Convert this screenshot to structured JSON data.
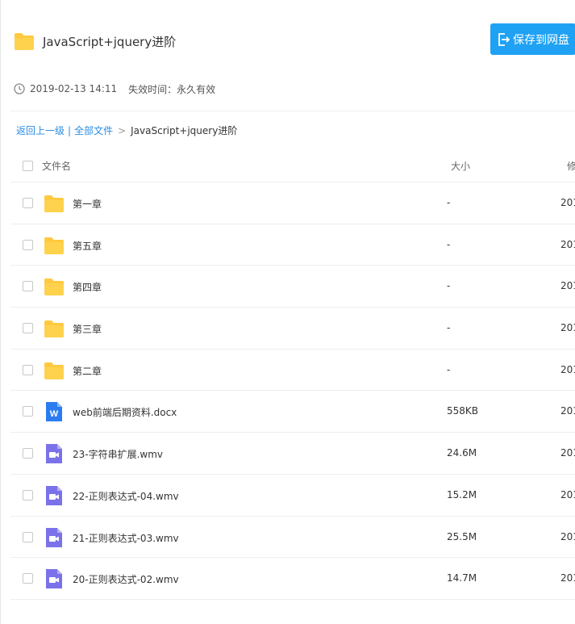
{
  "header": {
    "title": "JavaScript+jquery进阶",
    "save_button_label": "保存到网盘",
    "accent_color": "#1fa2f4"
  },
  "meta": {
    "share_time": "2019-02-13 14:11",
    "expiry_label": "失效时间：永久有效"
  },
  "breadcrumb": {
    "back_label": "返回上一级",
    "separator": "|",
    "all_files_label": "全部文件",
    "arrow": ">",
    "current": "JavaScript+jquery进阶"
  },
  "table": {
    "columns": {
      "name": "文件名",
      "size": "大小",
      "modified": "修"
    },
    "rows": [
      {
        "name": "第一章",
        "type": "folder",
        "size": "-",
        "date": "201"
      },
      {
        "name": "第五章",
        "type": "folder",
        "size": "-",
        "date": "201"
      },
      {
        "name": "第四章",
        "type": "folder",
        "size": "-",
        "date": "201"
      },
      {
        "name": "第三章",
        "type": "folder",
        "size": "-",
        "date": "201"
      },
      {
        "name": "第二章",
        "type": "folder",
        "size": "-",
        "date": "201"
      },
      {
        "name": "web前端后期资料.docx",
        "type": "word",
        "size": "558KB",
        "date": "201"
      },
      {
        "name": "23-字符串扩展.wmv",
        "type": "video",
        "size": "24.6M",
        "date": "201"
      },
      {
        "name": "22-正则表达式-04.wmv",
        "type": "video",
        "size": "15.2M",
        "date": "201"
      },
      {
        "name": "21-正则表达式-03.wmv",
        "type": "video",
        "size": "25.5M",
        "date": "201"
      },
      {
        "name": "20-正则表达式-02.wmv",
        "type": "video",
        "size": "14.7M",
        "date": "201"
      }
    ]
  },
  "icons": {
    "folder_color": "#ffc940",
    "word_color": "#2b7cf0",
    "video_color": "#7b72e9"
  }
}
